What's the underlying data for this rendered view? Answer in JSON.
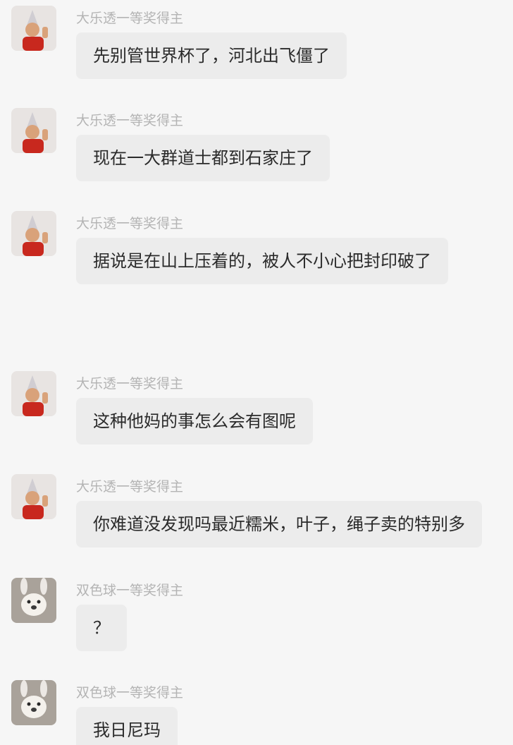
{
  "messages": [
    {
      "sender": "大乐透一等奖得主",
      "text": "先别管世界杯了，河北出飞僵了",
      "avatar": "boy-party-hat-avatar"
    },
    {
      "sender": "大乐透一等奖得主",
      "text": "现在一大群道士都到石家庄了",
      "avatar": "boy-party-hat-avatar"
    },
    {
      "sender": "大乐透一等奖得主",
      "text": "据说是在山上压着的，被人不小心把封印破了",
      "avatar": "boy-party-hat-avatar"
    },
    {
      "sender": "大乐透一等奖得主",
      "text": "这种他妈的事怎么会有图呢",
      "avatar": "boy-party-hat-avatar"
    },
    {
      "sender": "大乐透一等奖得主",
      "text": "你难道没发现吗最近糯米，叶子，绳子卖的特别多",
      "avatar": "boy-party-hat-avatar"
    },
    {
      "sender": "双色球一等奖得主",
      "text": "？",
      "avatar": "dog-bunny-ears-avatar"
    },
    {
      "sender": "双色球一等奖得主",
      "text": "我日尼玛",
      "avatar": "dog-bunny-ears-avatar"
    }
  ]
}
